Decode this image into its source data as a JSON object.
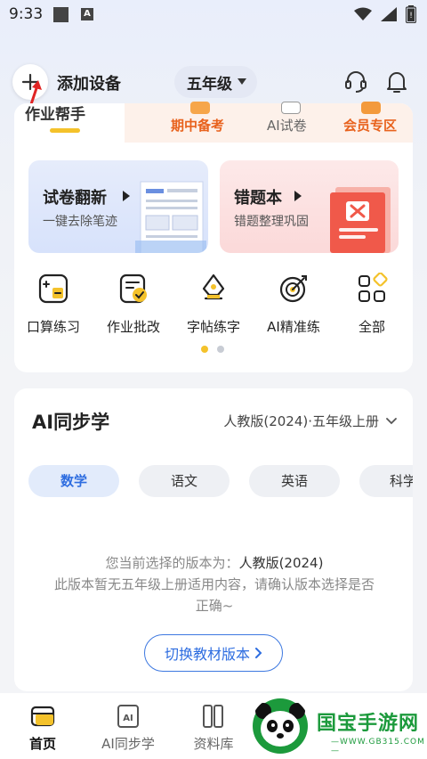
{
  "status_bar": {
    "time": "9:33",
    "notif_icon_a": "A"
  },
  "top_bar": {
    "add_label": "添加设备",
    "grade": "五年级",
    "support_icon": "headset-icon",
    "bell_icon": "bell-icon"
  },
  "homework_tabs": {
    "active": "作业帮手",
    "midterm": "期中备考",
    "ai_paper": "AI试卷",
    "vip": "会员专区"
  },
  "promos": {
    "left_title": "试卷翻新",
    "left_sub": "一键去除笔迹",
    "right_title": "错题本",
    "right_sub": "错题整理巩固"
  },
  "functions": [
    {
      "label": "口算练习",
      "icon": "calculator-icon"
    },
    {
      "label": "作业批改",
      "icon": "correct-icon"
    },
    {
      "label": "字帖练字",
      "icon": "pen-nib-icon"
    },
    {
      "label": "AI精准练",
      "icon": "target-icon"
    },
    {
      "label": "全部",
      "icon": "grid-icon"
    }
  ],
  "colors": {
    "accent": "#2e6de0",
    "highlight": "#f4c22b",
    "orange": "#e8621d"
  },
  "ai_sync": {
    "title": "AI同步学",
    "version": "人教版(2024)·五年级上册",
    "subjects": [
      "数学",
      "语文",
      "英语",
      "科学"
    ],
    "notice_prefix": "您当前选择的版本为：",
    "notice_version": "人教版(2024)",
    "notice_rest": "此版本暂无五年级上册适用内容，请确认版本选择是否正确~",
    "switch_label": "切换教材版本"
  },
  "bottom_nav": [
    {
      "label": "首页",
      "icon": "home-icon"
    },
    {
      "label": "AI同步学",
      "icon": "ai-book-icon"
    },
    {
      "label": "资料库",
      "icon": "library-icon"
    }
  ],
  "watermark": {
    "text": "国宝手游网",
    "url": "—WWW.GB315.COM—"
  }
}
